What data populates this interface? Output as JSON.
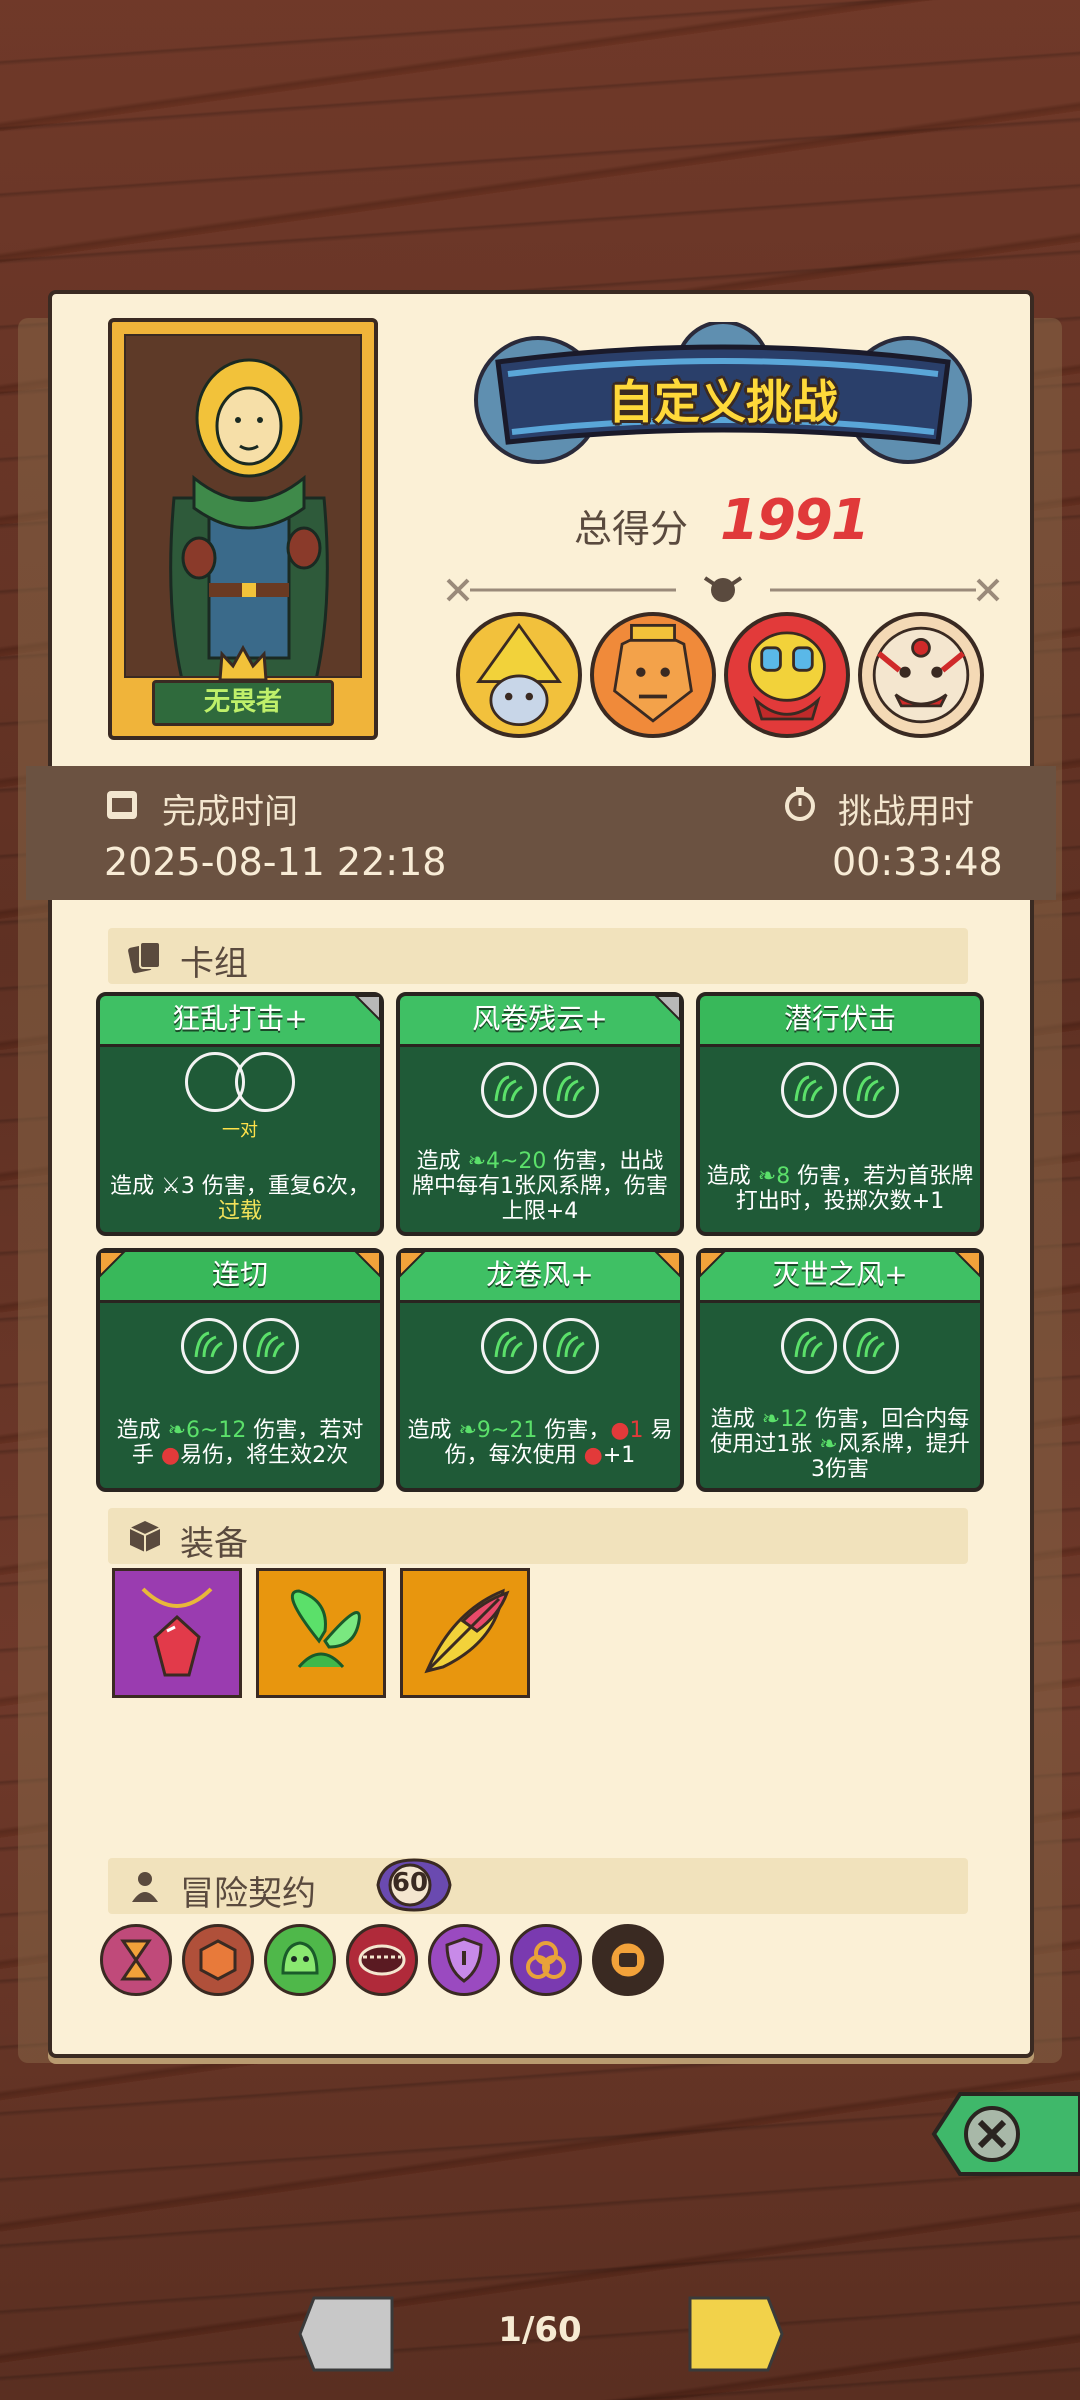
{
  "hero": {
    "name": "无畏者"
  },
  "banner": {
    "title": "自定义挑战"
  },
  "score": {
    "label": "总得分",
    "value": "1991"
  },
  "bosses": [
    {
      "name": "yellow-hat-witch-portrait",
      "color": "#f2c13c"
    },
    {
      "name": "orange-beast-portrait",
      "color": "#f08a3a"
    },
    {
      "name": "yellow-skull-demon-portrait",
      "color": "#f2d23a"
    },
    {
      "name": "red-oni-mask-portrait",
      "color": "#f4d9b5"
    }
  ],
  "times": {
    "finish_label": "完成时间",
    "finish_value": "2025-08-11 22:18",
    "duration_label": "挑战用时",
    "duration_value": "00:33:48"
  },
  "deck": {
    "title": "卡组",
    "cards": [
      {
        "name": "狂乱打击+",
        "pair_label": "一对",
        "desc_a": "造成 ",
        "icon_a": "swords-icon",
        "desc_b": "3 伤害，重复6次，",
        "desc_c": "过载"
      },
      {
        "name": "风卷残云+",
        "desc_a": "造成 ",
        "green": "4~20",
        "desc_b": " 伤害，出战牌中每有1张风系牌，伤害上限+4"
      },
      {
        "name": "潜行伏击",
        "desc_a": "造成 ",
        "green": "8",
        "desc_b": " 伤害，若为首张牌打出时，投掷次数+1"
      },
      {
        "name": "连切",
        "desc_a": "造成 ",
        "green": "6~12",
        "desc_b": " 伤害，若对手 ",
        "desc_c": "易伤，将生效2次"
      },
      {
        "name": "龙卷风+",
        "desc_a": "造成 ",
        "green": "9~21",
        "desc_b": " 伤害，",
        "red": "1",
        "desc_c": " 易伤，每次使用 ",
        "desc_d": "+1"
      },
      {
        "name": "灭世之风+",
        "desc_a": "造成 ",
        "green": "12",
        "desc_b": " 伤害，回合内每使用过1张 ",
        "desc_c": "风系牌，提升3伤害"
      }
    ]
  },
  "equipment": {
    "title": "装备",
    "items": [
      {
        "name": "red-gem-necklace-icon",
        "bg": "#9a3cb0"
      },
      {
        "name": "green-fairy-wings-icon",
        "bg": "#e8960e"
      },
      {
        "name": "flame-feather-icon",
        "bg": "#e8960e"
      }
    ]
  },
  "contract": {
    "title": "冒险契约",
    "level": "60",
    "items": [
      {
        "name": "hourglass-contract-icon",
        "color": "#c04a7a"
      },
      {
        "name": "cube-contract-icon",
        "color": "#b0503a"
      },
      {
        "name": "slime-contract-icon",
        "color": "#4fb84a"
      },
      {
        "name": "jaws-contract-icon",
        "color": "#b02a3a"
      },
      {
        "name": "shield-contract-icon",
        "color": "#9a4ac0"
      },
      {
        "name": "triquetra-contract-icon",
        "color": "#7a3ab0"
      },
      {
        "name": "fist-contract-icon",
        "color": "#f2a23a"
      }
    ]
  },
  "pager": {
    "text": "1/60"
  },
  "colors": {
    "accent_green": "#38b85a",
    "card_bg": "#1f5a37",
    "score_red": "#e0393a",
    "paper": "#fbf0d6"
  }
}
